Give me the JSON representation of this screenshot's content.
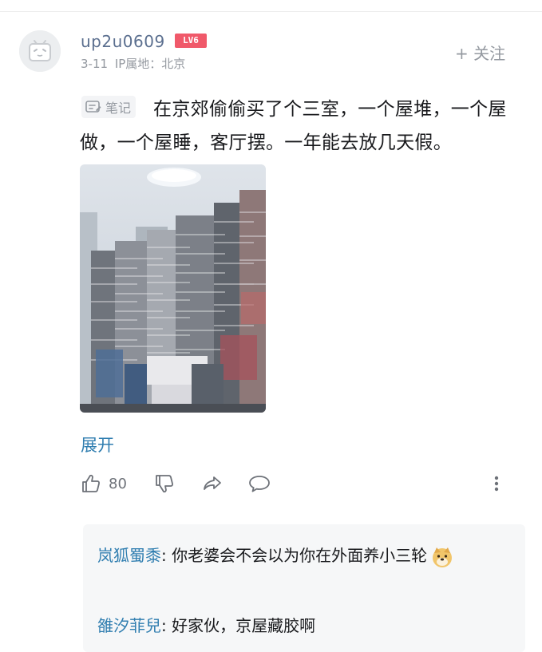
{
  "user": {
    "name": "up2u0609",
    "level": "LV6",
    "date": "3-11",
    "location": "IP属地：北京",
    "follow_label": "+ 关注"
  },
  "post": {
    "tag_label": "笔记",
    "text": "在京郊偷偷买了个三室，一个屋堆，一个屋做，一个屋睡，客厅摆。一年能去放几天假。",
    "expand_label": "展开"
  },
  "actions": {
    "like_count": "80"
  },
  "replies": [
    {
      "name": "岚狐蜀黍",
      "sep": ": ",
      "text": "你老婆会不会以为你在外面养小三轮"
    },
    {
      "name": "雒汐菲兒",
      "sep": ": ",
      "text": "好家伙，京屋藏胶啊"
    }
  ],
  "colors": {
    "username": "#5b6f8f",
    "level_badge": "#f0596a",
    "link": "#307eb0",
    "muted": "#9499a0"
  },
  "icons": [
    "bilibili-tv-avatar",
    "note-icon",
    "thumbs-up-icon",
    "thumbs-down-icon",
    "share-icon",
    "comment-icon",
    "more-vertical-icon",
    "doge-emoji"
  ]
}
